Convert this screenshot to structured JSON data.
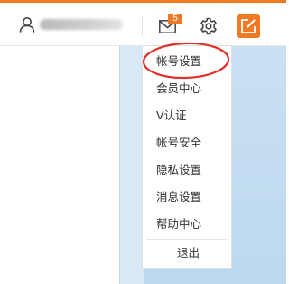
{
  "header": {
    "user_icon": "user-icon",
    "username": "",
    "mail_icon": "envelope-icon",
    "mail_badge": "5",
    "settings_icon": "gear-icon",
    "compose_icon": "edit-icon"
  },
  "menu": {
    "items": [
      {
        "label": "帐号设置"
      },
      {
        "label": "会员中心"
      },
      {
        "label": "V认证"
      },
      {
        "label": "帐号安全"
      },
      {
        "label": "隐私设置"
      },
      {
        "label": "消息设置"
      },
      {
        "label": "帮助中心"
      }
    ],
    "logout_label": "退出"
  },
  "annotation": {
    "highlight_color": "#e0302b",
    "highlighted_item": "帐号设置"
  },
  "colors": {
    "accent": "#f07a23",
    "text": "#333333",
    "panel_bg": "#d9e9f7"
  }
}
